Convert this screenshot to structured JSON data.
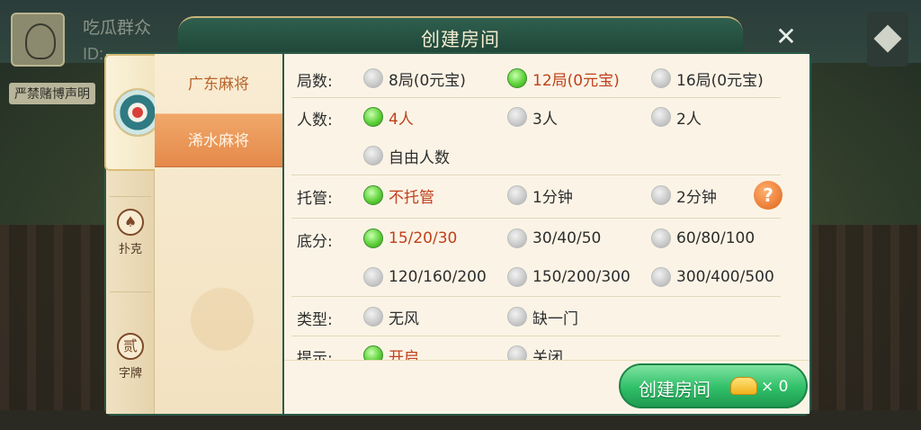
{
  "background": {
    "player_name": "吃瓜群众",
    "player_id": "ID:",
    "warning": "严禁赌博声明"
  },
  "dialog": {
    "title": "创建房间",
    "close_icon": "close-icon"
  },
  "categories": [
    {
      "icon": "mahjong-emblem-icon",
      "label": "",
      "active": true
    },
    {
      "icon": "spade-icon",
      "glyph": "♠",
      "label": "扑克",
      "active": false
    },
    {
      "icon": "zipai-icon",
      "glyph": "贰",
      "label": "字牌",
      "active": false
    }
  ],
  "subtabs": [
    {
      "label": "广东麻将",
      "active": false
    },
    {
      "label": "浠水麻将",
      "active": true
    }
  ],
  "rows": {
    "rounds": {
      "label": "局数:",
      "options": [
        {
          "text": "8局(0元宝)",
          "selected": false
        },
        {
          "text": "12局(0元宝)",
          "selected": true
        },
        {
          "text": "16局(0元宝)",
          "selected": false
        }
      ]
    },
    "players": {
      "label": "人数:",
      "options": [
        {
          "text": "4人",
          "selected": true
        },
        {
          "text": "3人",
          "selected": false
        },
        {
          "text": "2人",
          "selected": false
        },
        {
          "text": "自由人数",
          "selected": false
        }
      ]
    },
    "auto_play": {
      "label": "托管:",
      "options": [
        {
          "text": "不托管",
          "selected": true
        },
        {
          "text": "1分钟",
          "selected": false
        },
        {
          "text": "2分钟",
          "selected": false
        }
      ],
      "help": "?"
    },
    "base_score": {
      "label": "底分:",
      "options": [
        {
          "text": "15/20/30",
          "selected": true
        },
        {
          "text": "30/40/50",
          "selected": false
        },
        {
          "text": "60/80/100",
          "selected": false
        },
        {
          "text": "120/160/200",
          "selected": false
        },
        {
          "text": "150/200/300",
          "selected": false
        },
        {
          "text": "300/400/500",
          "selected": false
        }
      ]
    },
    "type": {
      "label": "类型:",
      "options": [
        {
          "text": "无风",
          "selected": false
        },
        {
          "text": "缺一门",
          "selected": false
        }
      ]
    },
    "hint": {
      "label": "提示:",
      "options": [
        {
          "text": "开启",
          "selected": true
        },
        {
          "text": "关闭",
          "selected": false
        }
      ]
    }
  },
  "create_button": {
    "label": "创建房间",
    "cost_icon": "gold-ingot-icon",
    "cost": "× 0"
  }
}
